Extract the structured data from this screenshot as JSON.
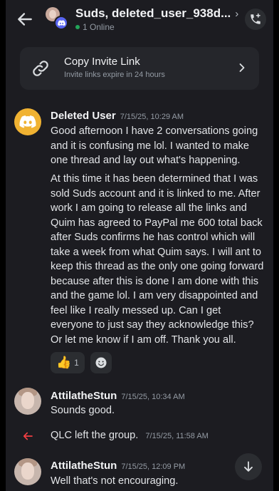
{
  "header": {
    "title": "Suds, deleted_user_938d...",
    "online_count": "1 Online",
    "chevron_icon": "chevron-right-icon",
    "call_icon": "phone-add-icon"
  },
  "invite": {
    "title": "Copy Invite Link",
    "subtitle": "Invite links expire in 24 hours"
  },
  "messages": [
    {
      "author": "Deleted User",
      "timestamp": "7/15/25, 10:29 AM",
      "paragraphs": [
        "Good afternoon I have 2 conversations going and it is confusing me lol. I wanted to make one thread and lay out what's happening.",
        "At this time it has been determined that I was sold Suds account and it is linked to me. After work I am going to release all the links and Quim has agreed to PayPal me 600 total back after Suds confirms he has control which will take a week from what Quim says. I will ant to keep this thread as the only one going forward because after this is done I am done with this and the game lol. I am very disappointed and feel like I really messed up. Can I get everyone to just say they acknowledge this? Or let me know if I am off. Thank you all."
      ],
      "reactions": [
        {
          "emoji": "👍",
          "count": "1"
        }
      ]
    },
    {
      "author": "AttilatheStun",
      "timestamp": "7/15/25, 10:34 AM",
      "text": "Sounds good."
    },
    {
      "author": "AttilatheStun",
      "timestamp": "7/15/25, 12:09 PM",
      "text": "Well that's not encouraging."
    }
  ],
  "system": {
    "text": "QLC left the group.",
    "timestamp": "7/15/25, 11:58 AM"
  },
  "colors": {
    "background": "#1c1c21",
    "accent": "#5865f2",
    "online": "#23a55a",
    "leave_arrow": "#f23f43",
    "deleted_avatar": "#f0b232"
  }
}
